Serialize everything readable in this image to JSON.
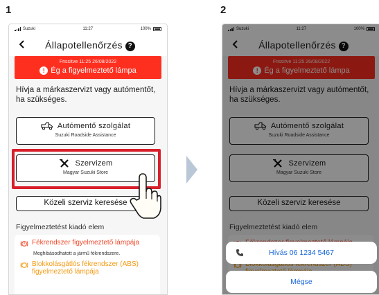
{
  "steps": {
    "one": "1",
    "two": "2"
  },
  "status_bar": {
    "carrier": "Suzuki",
    "time": "11:27",
    "battery": "100%"
  },
  "nav": {
    "title": "Állapotellenőrzés",
    "help": "?"
  },
  "alert": {
    "updated": "Frissítve 11:25 26/08/2022",
    "message": "Ég a figyelmeztető lámpa",
    "bg_color": "#ff2f1f"
  },
  "advice": "Hívja a márkaszervizt vagy autómentőt, ha szükséges.",
  "buttons": {
    "tow": {
      "label": "Autómentő szolgálat",
      "sub": "Suzuki Roadside Assistance"
    },
    "service": {
      "label": "Szervizem",
      "sub": "Magyar Suzuki Store"
    },
    "search": {
      "label": "Közeli szerviz keresése"
    }
  },
  "section_title": "Figyelmeztetést kiadó elem",
  "warnings": [
    {
      "title": "Fékrendszer figyelmeztető lámpája",
      "desc": "Meghibásodhatott a jármű fékrendszere.",
      "color": "#f04a2c",
      "icon": "brake-warning-icon"
    },
    {
      "title": "Blokkolásgátlós fékrendszer (ABS) figyelmeztető lámpája",
      "color": "#f39a12",
      "icon": "abs-warning-icon"
    }
  ],
  "action_sheet": {
    "call": "Hívás 06 1234 5467",
    "cancel": "Mégse"
  },
  "highlight_color": "#d81e2a"
}
